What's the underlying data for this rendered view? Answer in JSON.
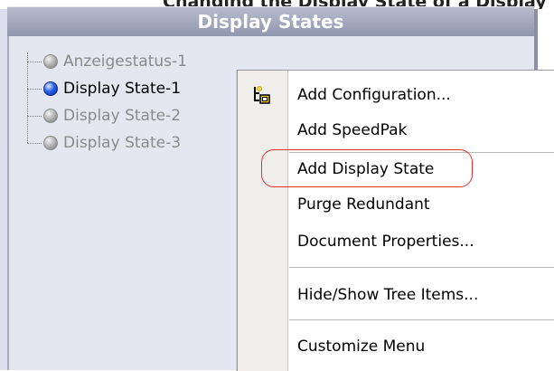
{
  "panel": {
    "title": "Display States"
  },
  "tree": {
    "items": [
      {
        "label": "Anzeigestatus-1",
        "state": "inactive"
      },
      {
        "label": "Display State-1",
        "state": "active"
      },
      {
        "label": "Display State-2",
        "state": "inactive"
      },
      {
        "label": "Display State-3",
        "state": "inactive"
      }
    ]
  },
  "context_menu": {
    "items": [
      {
        "label": "Add Configuration...",
        "icon": "add-configuration-icon"
      },
      {
        "label": "Add SpeedPak"
      },
      {
        "label": "Add Display State",
        "highlighted": true
      },
      {
        "label": "Purge Redundant"
      },
      {
        "label": "Document Properties..."
      },
      {
        "label": "Hide/Show Tree Items..."
      },
      {
        "label": "Customize Menu"
      }
    ]
  },
  "colors": {
    "panel_bg": "#dde0ec",
    "header_bg": "#9ea3b9",
    "active_ball": "#2a5fe6",
    "inactive_ball": "#a9a9a9",
    "annotation_oval": "#e03030"
  }
}
